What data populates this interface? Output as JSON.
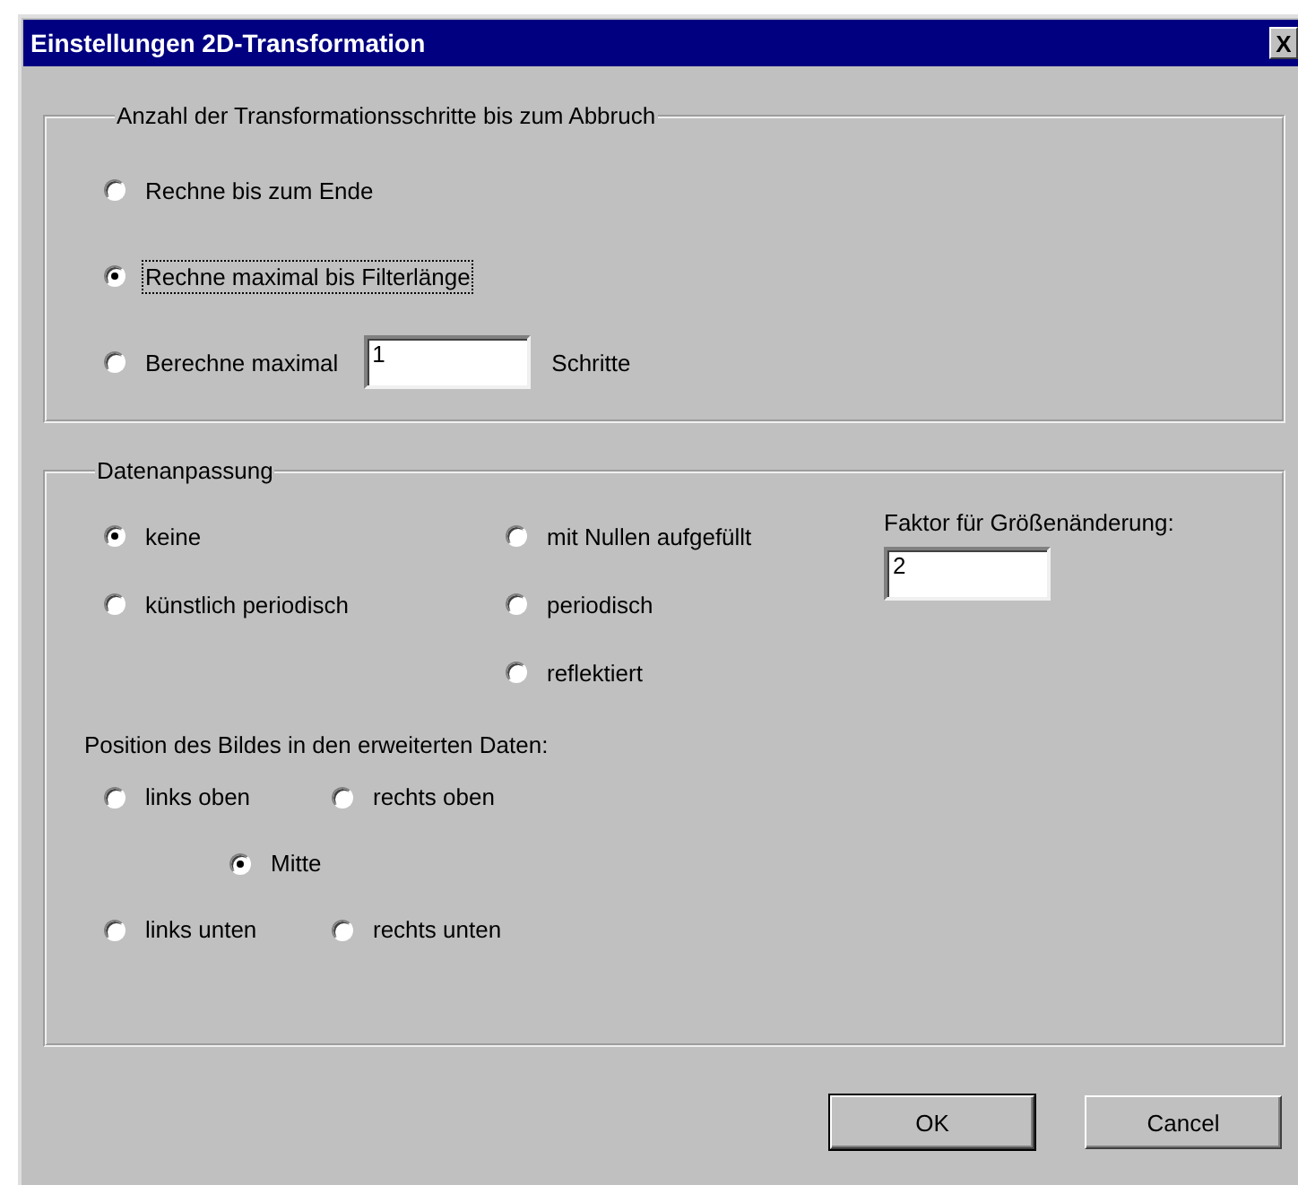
{
  "window": {
    "title": "Einstellungen 2D-Transformation",
    "close_label": "X"
  },
  "steps_group": {
    "title": "Anzahl der Transformationsschritte bis zum Abbruch",
    "options": [
      {
        "kind": "radio",
        "label": "Rechne bis zum Ende",
        "selected": false,
        "focused": false
      },
      {
        "kind": "radio",
        "label": "Rechne maximal bis Filterlänge",
        "selected": true,
        "focused": true
      },
      {
        "kind": "radio-field",
        "label": "Berechne maximal",
        "value": "1",
        "suffix": "Schritte",
        "selected": false,
        "focused": false
      }
    ]
  },
  "data_group": {
    "title": "Datenanpassung",
    "mode_columns": [
      {
        "options": [
          {
            "label": "keine",
            "selected": true
          },
          {
            "label": "künstlich periodisch",
            "selected": false
          }
        ]
      },
      {
        "options": [
          {
            "label": "mit Nullen aufgefüllt",
            "selected": false
          },
          {
            "label": "periodisch",
            "selected": false
          },
          {
            "label": "reflektiert",
            "selected": false
          }
        ]
      }
    ],
    "factor": {
      "label": "Faktor für Größenänderung:",
      "value": "2"
    },
    "position": {
      "label": "Position des Bildes in den erweiterten Daten:",
      "rows": [
        {
          "options": [
            {
              "label": "links oben",
              "selected": false
            },
            {
              "label": "rechts oben",
              "selected": false
            }
          ]
        },
        {
          "options": [
            {
              "label": "Mitte",
              "selected": true
            }
          ]
        },
        {
          "options": [
            {
              "label": "links unten",
              "selected": false
            },
            {
              "label": "rechts unten",
              "selected": false
            }
          ]
        }
      ]
    }
  },
  "buttons": [
    {
      "label": "OK",
      "default": true
    },
    {
      "label": "Cancel",
      "default": false
    }
  ]
}
